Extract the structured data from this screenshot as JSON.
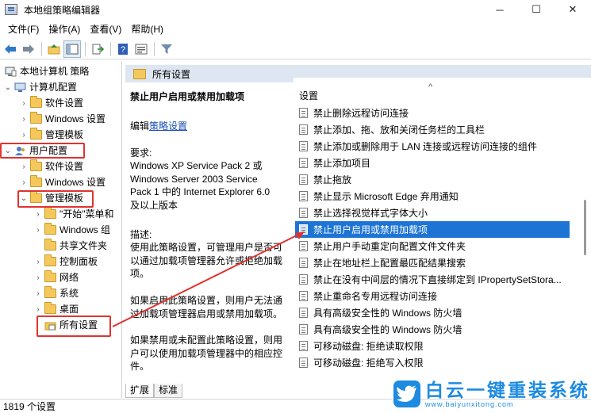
{
  "window": {
    "title": "本地组策略编辑器",
    "minimize": "─",
    "maximize": "☐",
    "close": "✕"
  },
  "menu": [
    "文件(F)",
    "操作(A)",
    "查看(V)",
    "帮助(H)"
  ],
  "toolbar": [
    "back-icon",
    "forward-icon",
    "up-folder-icon",
    "show-hide-tree-icon",
    "export-list-icon",
    "help-icon",
    "properties-icon",
    "filter-icon"
  ],
  "tree": {
    "root": "本地计算机 策略",
    "computer_config": "计算机配置",
    "cc_software": "软件设置",
    "cc_windows": "Windows 设置",
    "cc_admin": "管理模板",
    "user_config": "用户配置",
    "uc_software": "软件设置",
    "uc_windows": "Windows 设置",
    "uc_admin": "管理模板",
    "start_menu": "\"开始\"菜单和",
    "windows_comp": "Windows 组",
    "shared_folder": "共享文件夹",
    "control_panel": "控制面板",
    "network": "网络",
    "system": "系统",
    "desktop": "桌面",
    "all_settings": "所有设置"
  },
  "header": {
    "title": "所有设置"
  },
  "description": {
    "policy_title": "禁止用户启用或禁用加载项",
    "edit_prefix": "编辑",
    "edit_link": "策略设置",
    "req_label": "要求:",
    "req_line1": "Windows XP Service Pack 2 或",
    "req_line2": "Windows Server 2003 Service",
    "req_line3": "Pack 1 中的 Internet Explorer 6.0",
    "req_line4": "及以上版本",
    "desc_label": "描述:",
    "desc_line1": "使用此策略设置，可管理用户是否可",
    "desc_line2": "以通过加载项管理器允许或拒绝加载",
    "desc_line3": "项。",
    "enabled_line1": "如果启用此策略设置，则用户无法通",
    "enabled_line2": "过加载项管理器启用或禁用加载项。",
    "disabled_line1": "如果禁用或未配置此策略设置，则用",
    "disabled_line2": "户可以使用加载项管理器中的相应控",
    "disabled_line3": "件。"
  },
  "list": {
    "header": "设置",
    "items": [
      "禁止删除远程访问连接",
      "禁止添加、拖、放和关闭任务栏的工具栏",
      "禁止添加或删除用于 LAN 连接或远程访问连接的组件",
      "禁止添加项目",
      "禁止拖放",
      "禁止显示 Microsoft Edge 弃用通知",
      "禁止选择视觉样式字体大小",
      "禁止用户启用或禁用加载项",
      "禁止用户手动重定向配置文件文件夹",
      "禁止在地址栏上配置最匹配结果搜索",
      "禁止在没有中间层的情况下直接绑定到 IPropertySetStora...",
      "禁止重命名专用远程访问连接",
      "具有高级安全性的 Windows 防火墙",
      "具有高级安全性的 Windows 防火墙",
      "可移动磁盘: 拒绝读取权限",
      "可移动磁盘: 拒绝写入权限"
    ],
    "selected_index": 7
  },
  "tabs": [
    "扩展",
    "标准"
  ],
  "status": "1819 个设置",
  "watermark": {
    "brand": "白云一键重装系统",
    "url": "www.baiyunxitong.com"
  },
  "colors": {
    "selection": "#1d74d4",
    "highlight_box": "#e0332f",
    "header_bg": "#dde6f1",
    "brand": "#1d8be0"
  }
}
